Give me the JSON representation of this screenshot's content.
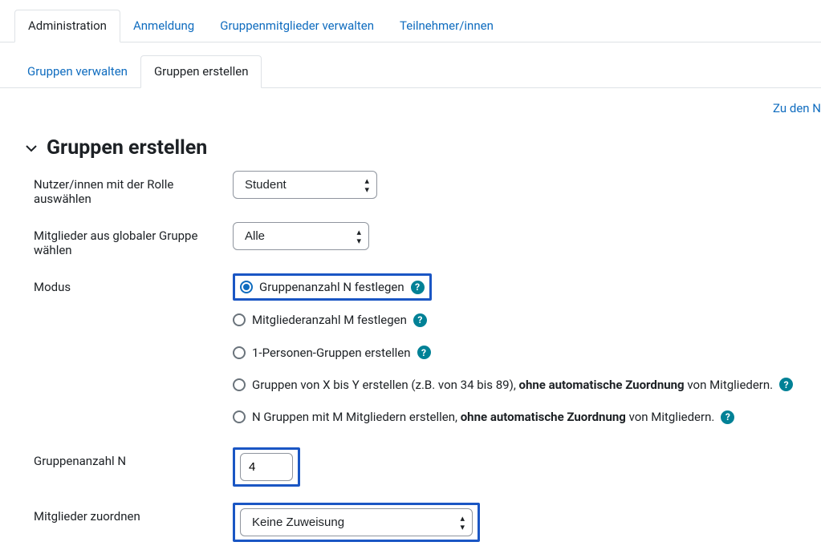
{
  "topTabs": {
    "administration": "Administration",
    "anmeldung": "Anmeldung",
    "gruppenmitglieder": "Gruppenmitglieder verwalten",
    "teilnehmer": "Teilnehmer/innen"
  },
  "subTabs": {
    "verwalten": "Gruppen verwalten",
    "erstellen": "Gruppen erstellen"
  },
  "topRightLink": "Zu den N",
  "section": {
    "title": "Gruppen erstellen"
  },
  "labels": {
    "role": "Nutzer/innen mit der Rolle auswählen",
    "globalGroup": "Mitglieder aus globaler Gruppe wählen",
    "modus": "Modus",
    "groupCount": "Gruppenanzahl N",
    "assign": "Mitglieder zuordnen"
  },
  "selects": {
    "role": {
      "value": "Student"
    },
    "globalGroup": {
      "value": "Alle"
    },
    "assign": {
      "value": "Keine Zuweisung"
    }
  },
  "radios": {
    "opt1": "Gruppenanzahl N festlegen",
    "opt2": "Mitgliederanzahl M festlegen",
    "opt3": "1-Personen-Gruppen erstellen",
    "opt4_a": "Gruppen von X bis Y erstellen (z.B. von 34 bis 89), ",
    "opt4_b": "ohne automatische Zuordnung",
    "opt4_c": " von Mitgliedern.",
    "opt5_a": "N Gruppen mit M Mitgliedern erstellen, ",
    "opt5_b": "ohne automatische Zuordnung",
    "opt5_c": " von Mitgliedern."
  },
  "inputs": {
    "groupCount": "4"
  }
}
